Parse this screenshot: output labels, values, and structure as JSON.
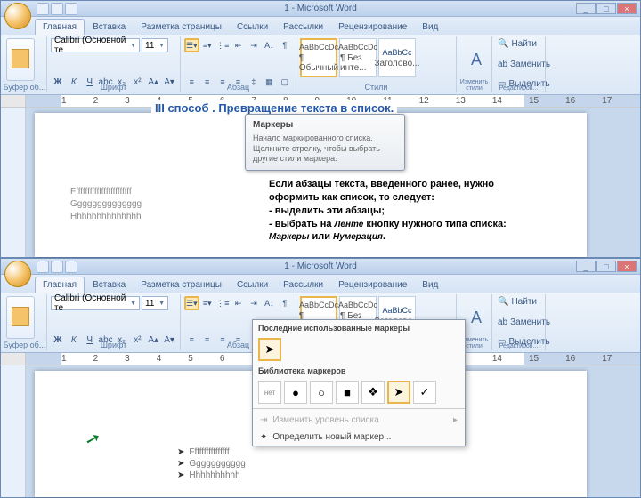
{
  "app_title": "1 - Microsoft Word",
  "tabs": [
    "Главная",
    "Вставка",
    "Разметка страницы",
    "Ссылки",
    "Рассылки",
    "Рецензирование",
    "Вид"
  ],
  "groups": {
    "clipboard": "Буфер об...",
    "font": "Шрифт",
    "paragraph": "Абзац",
    "styles": "Стили",
    "change": "Изменить стили",
    "editing": "Редактиров..."
  },
  "font": {
    "name": "Calibri (Основной те",
    "size": "11"
  },
  "styles_gallery": [
    {
      "sample": "AaBbCcDc",
      "label": "¶ Обычный",
      "color": "#000"
    },
    {
      "sample": "AaBbCcDc",
      "label": "¶ Без инте...",
      "color": "#000"
    },
    {
      "sample": "AaBbCc",
      "label": "Заголово...",
      "color": "#1f497d"
    }
  ],
  "editing": {
    "find": "Найти",
    "replace": "Заменить",
    "select": "Выделить"
  },
  "overlay_title": "III способ . Превращение текста в список.",
  "tooltip": {
    "title": "Маркеры",
    "body": "Начало маркированного списка.\n\nЩелкните стрелку, чтобы выбрать другие стили маркера."
  },
  "content_lines": [
    "Если абзацы текста, введенного ранее, нужно",
    "оформить как список, то следует:",
    "- выделить эти абзацы;",
    "- выбрать на <em>Ленте</em> кнопку нужного типа списка:",
    "  <em>Маркеры</em> или <em>Нумерация</em>."
  ],
  "dropdown": {
    "recent_label": "Последние использованные маркеры",
    "recent": [
      "➤"
    ],
    "library_label": "Библиотека маркеров",
    "library": [
      "нет",
      "●",
      "○",
      "■",
      "❖",
      "➤",
      "✓"
    ],
    "change_level": "Изменить уровень списка",
    "define_new": "Определить новый маркер..."
  },
  "sample_para": [
    "Fffffffffffffffffffffffff",
    "Gggggggggggggg",
    "Hhhhhhhhhhhhhh"
  ],
  "bullet_sample": [
    "Ffffffffffffffff",
    "Ggggggggggg",
    "Hhhhhhhhhh"
  ],
  "ruler_numbers": [
    "1",
    "2",
    "3",
    "4",
    "5",
    "6",
    "7",
    "8",
    "9",
    "10",
    "11",
    "12",
    "13",
    "14",
    "15",
    "16",
    "17"
  ],
  "win": {
    "min": "_",
    "max": "□",
    "close": "×"
  }
}
